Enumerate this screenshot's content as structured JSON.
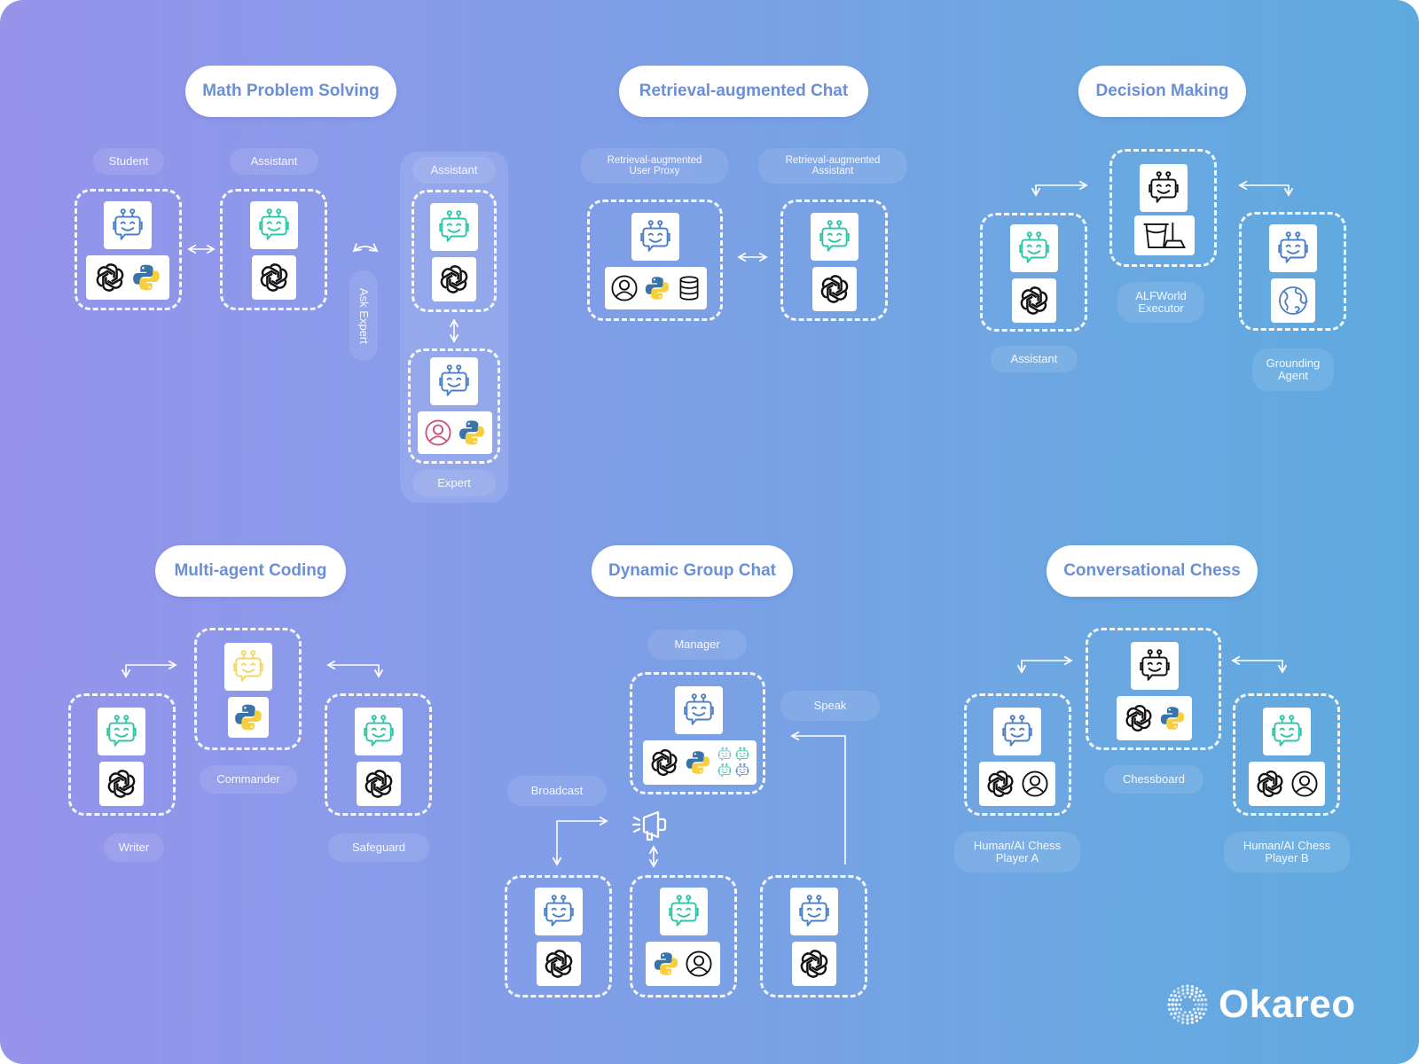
{
  "colors": {
    "bg_left": "#9693ea",
    "bg_right": "#5eaadf",
    "title_text": "#6b8fd6",
    "robot_blue": "#4a7fc4",
    "robot_teal": "#2ec4a8",
    "robot_yellow": "#f3d66a",
    "robot_black": "#111111",
    "user_pink": "#c9527a",
    "python_blue": "#3a73a8",
    "python_yellow": "#f7cf3c"
  },
  "sections": {
    "math": {
      "title": "Math Problem Solving",
      "student_label": "Student",
      "assistant_label": "Assistant",
      "expert_assistant_label": "Assistant",
      "ask_expert_label": "Ask Expert",
      "expert_label": "Expert"
    },
    "rag": {
      "title": "Retrieval-augmented Chat",
      "user_proxy_label": "Retrieval-augmented\nUser Proxy",
      "assistant_label": "Retrieval-augmented\nAssistant"
    },
    "decision": {
      "title": "Decision Making",
      "assistant_label": "Assistant",
      "executor_label": "ALFWorld\nExecutor",
      "grounding_label": "Grounding\nAgent"
    },
    "coding": {
      "title": "Multi-agent Coding",
      "writer_label": "Writer",
      "commander_label": "Commander",
      "safeguard_label": "Safeguard"
    },
    "group": {
      "title": "Dynamic Group Chat",
      "manager_label": "Manager",
      "speak_label": "Speak",
      "broadcast_label": "Broadcast"
    },
    "chess": {
      "title": "Conversational Chess",
      "player_a_label": "Human/AI Chess\nPlayer A",
      "chessboard_label": "Chessboard",
      "player_b_label": "Human/AI Chess\nPlayer B"
    }
  },
  "brand": {
    "name": "Okareo"
  }
}
